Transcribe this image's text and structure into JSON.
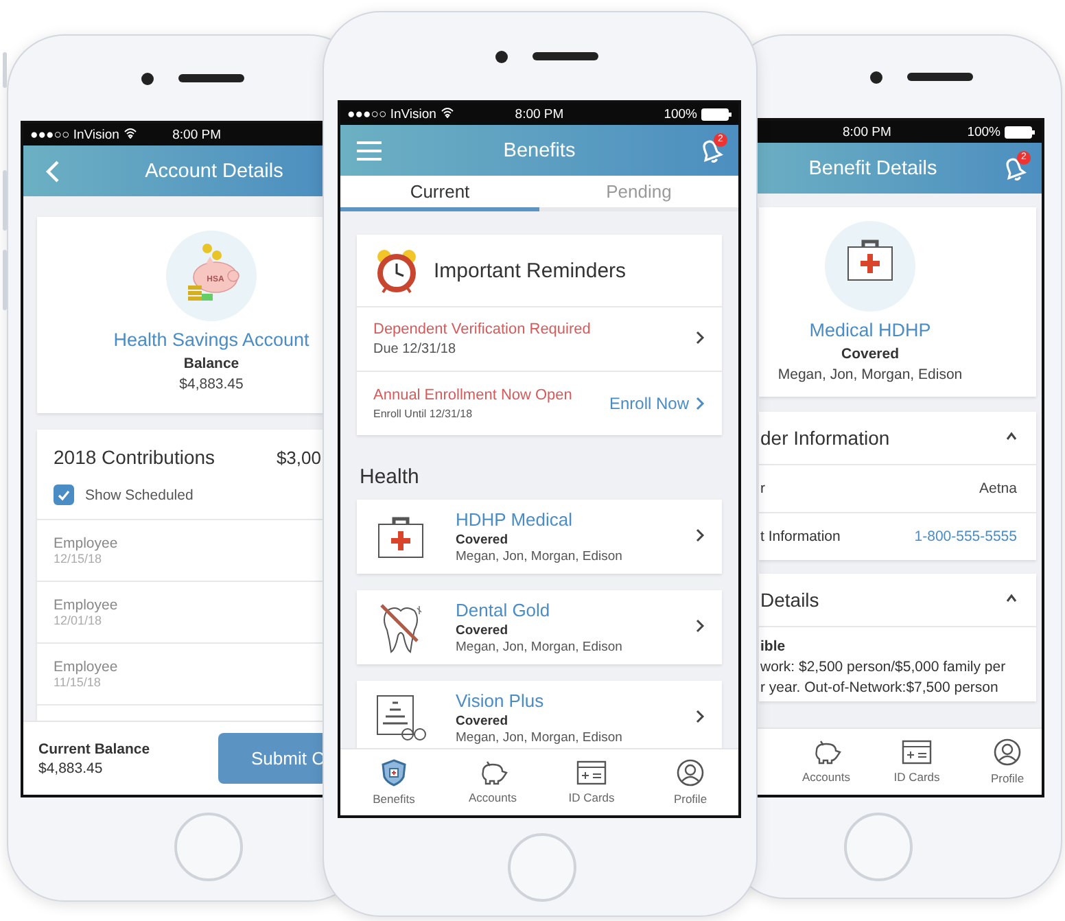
{
  "left_phone": {
    "status_bar": {
      "carrier": "●●●○○ InVision",
      "time": "8:00 PM"
    },
    "header": {
      "title": "Account Details"
    },
    "account_card": {
      "icon_label": "HSA",
      "name": "Health Savings Account",
      "label": "Balance",
      "amount": "$4,883.45"
    },
    "contributions": {
      "title": "2018 Contributions",
      "total": "$3,00",
      "show_scheduled": {
        "label": "Show Scheduled",
        "checked": true
      },
      "rows": [
        {
          "type": "Employee",
          "date": "12/15/18"
        },
        {
          "type": "Employee",
          "date": "12/01/18"
        },
        {
          "type": "Employee",
          "date": "11/15/18"
        }
      ]
    },
    "footer": {
      "label": "Current Balance",
      "amount": "$4,883.45",
      "button": "Submit C"
    }
  },
  "center_phone": {
    "status_bar": {
      "carrier": "●●●○○ InVision",
      "time": "8:00 PM",
      "battery": "100%"
    },
    "header": {
      "title": "Benefits",
      "notification_count": "2"
    },
    "tabs": [
      {
        "label": "Current",
        "selected": true
      },
      {
        "label": "Pending",
        "selected": false
      }
    ],
    "reminders": {
      "title": "Important Reminders",
      "items": [
        {
          "title": "Dependent Verification Required",
          "subtitle": "Due 12/31/18"
        },
        {
          "title": "Annual Enrollment Now Open",
          "subtitle": "Enroll Until 12/31/18",
          "action": "Enroll Now"
        }
      ]
    },
    "section_title": "Health",
    "benefits": [
      {
        "kind": "medical",
        "name": "HDHP Medical",
        "status": "Covered",
        "members": "Megan, Jon, Morgan, Edison"
      },
      {
        "kind": "dental",
        "name": "Dental Gold",
        "status": "Covered",
        "members": "Megan, Jon, Morgan, Edison"
      },
      {
        "kind": "vision",
        "name": "Vision Plus",
        "status": "Covered",
        "members": "Megan, Jon, Morgan, Edison"
      }
    ],
    "tab_bar": [
      {
        "kind": "shield",
        "label": "Benefits",
        "selected": true
      },
      {
        "kind": "piggy",
        "label": "Accounts",
        "selected": false
      },
      {
        "kind": "card",
        "label": "ID Cards",
        "selected": false
      },
      {
        "kind": "profile",
        "label": "Profile",
        "selected": false
      }
    ]
  },
  "right_phone": {
    "status_bar": {
      "time": "8:00 PM",
      "battery": "100%"
    },
    "header": {
      "title": "Benefit Details",
      "notification_count": "2"
    },
    "plan_card": {
      "name": "Medical HDHP",
      "status": "Covered",
      "members": "Megan, Jon, Morgan, Edison"
    },
    "provider_section": {
      "title": "der Information",
      "expanded": true,
      "rows": [
        {
          "kind": "text",
          "label": "r",
          "value": "Aetna"
        },
        {
          "kind": "link",
          "label": "t Information",
          "value": "1-800-555-5555"
        }
      ]
    },
    "details_section": {
      "title": "Details",
      "expanded": true,
      "heading": "ible",
      "lines": [
        "work: $2,500 person/$5,000 family per",
        "r year. Out-of-Network:$7,500 person"
      ]
    },
    "tab_bar": [
      {
        "kind": "piggy",
        "label": "Accounts",
        "selected": false
      },
      {
        "kind": "card",
        "label": "ID Cards",
        "selected": false
      },
      {
        "kind": "profile",
        "label": "Profile",
        "selected": false
      }
    ]
  }
}
